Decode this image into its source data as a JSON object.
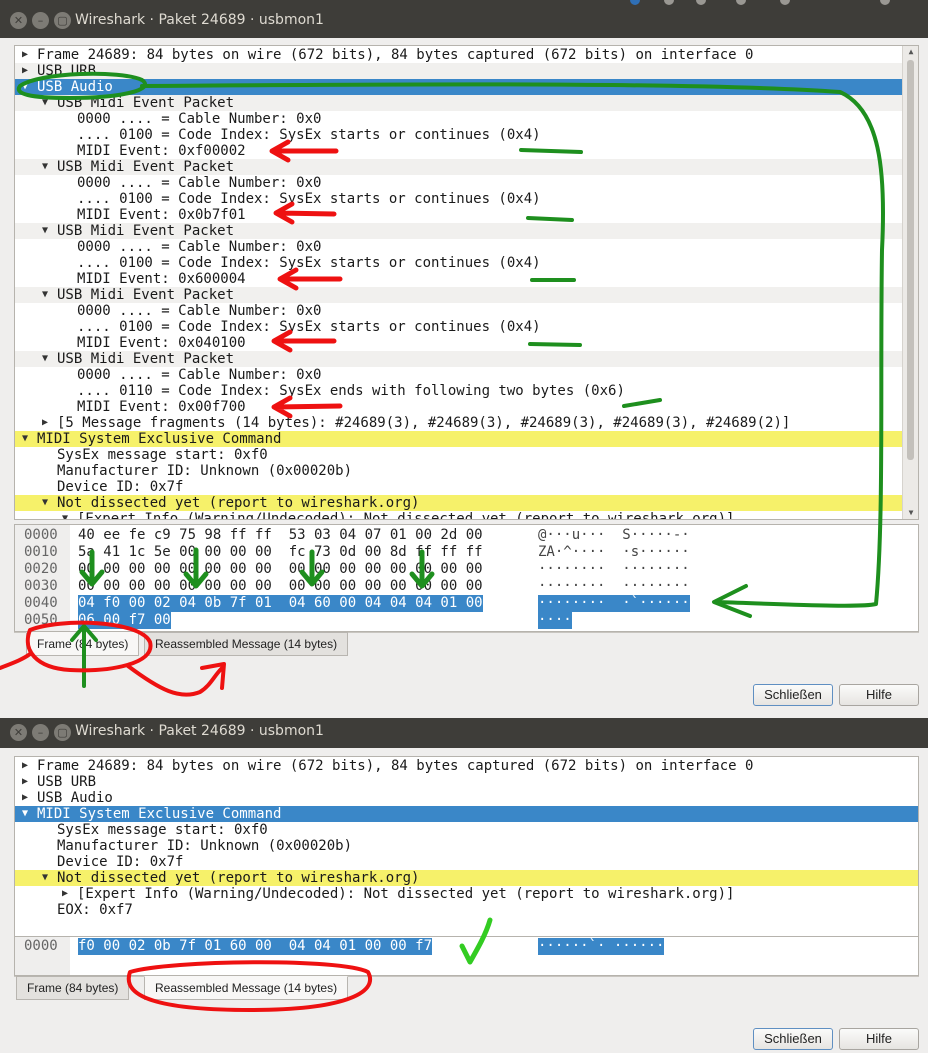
{
  "top_window": {
    "title": "Wireshark · Paket 24689 · usbmon1",
    "tree_rows": [
      {
        "text": "Frame 24689: 84 bytes on wire (672 bits), 84 bytes captured (672 bits) on interface 0",
        "expander": "collapsed",
        "level": 0,
        "style": "normal"
      },
      {
        "text": "USB URB",
        "expander": "collapsed",
        "level": 0,
        "style": "alt"
      },
      {
        "text": "USB Audio",
        "expander": "expanded",
        "level": 0,
        "style": "selected"
      },
      {
        "text": "USB Midi Event Packet",
        "expander": "expanded",
        "level": 1,
        "style": "alt"
      },
      {
        "text": "0000 .... = Cable Number: 0x0",
        "expander": "none",
        "level": 2,
        "style": "normal"
      },
      {
        "text": ".... 0100 = Code Index: SysEx starts or continues (0x4)",
        "expander": "none",
        "level": 2,
        "style": "normal"
      },
      {
        "text": "MIDI Event: 0xf00002",
        "expander": "none",
        "level": 2,
        "style": "normal"
      },
      {
        "text": "USB Midi Event Packet",
        "expander": "expanded",
        "level": 1,
        "style": "alt"
      },
      {
        "text": "0000 .... = Cable Number: 0x0",
        "expander": "none",
        "level": 2,
        "style": "normal"
      },
      {
        "text": ".... 0100 = Code Index: SysEx starts or continues (0x4)",
        "expander": "none",
        "level": 2,
        "style": "normal"
      },
      {
        "text": "MIDI Event: 0x0b7f01",
        "expander": "none",
        "level": 2,
        "style": "normal"
      },
      {
        "text": "USB Midi Event Packet",
        "expander": "expanded",
        "level": 1,
        "style": "alt"
      },
      {
        "text": "0000 .... = Cable Number: 0x0",
        "expander": "none",
        "level": 2,
        "style": "normal"
      },
      {
        "text": ".... 0100 = Code Index: SysEx starts or continues (0x4)",
        "expander": "none",
        "level": 2,
        "style": "normal"
      },
      {
        "text": "MIDI Event: 0x600004",
        "expander": "none",
        "level": 2,
        "style": "normal"
      },
      {
        "text": "USB Midi Event Packet",
        "expander": "expanded",
        "level": 1,
        "style": "alt"
      },
      {
        "text": "0000 .... = Cable Number: 0x0",
        "expander": "none",
        "level": 2,
        "style": "normal"
      },
      {
        "text": ".... 0100 = Code Index: SysEx starts or continues (0x4)",
        "expander": "none",
        "level": 2,
        "style": "normal"
      },
      {
        "text": "MIDI Event: 0x040100",
        "expander": "none",
        "level": 2,
        "style": "normal"
      },
      {
        "text": "USB Midi Event Packet",
        "expander": "expanded",
        "level": 1,
        "style": "alt"
      },
      {
        "text": "0000 .... = Cable Number: 0x0",
        "expander": "none",
        "level": 2,
        "style": "normal"
      },
      {
        "text": ".... 0110 = Code Index: SysEx ends with following two bytes (0x6)",
        "expander": "none",
        "level": 2,
        "style": "normal"
      },
      {
        "text": "MIDI Event: 0x00f700",
        "expander": "none",
        "level": 2,
        "style": "normal"
      },
      {
        "text": "[5 Message fragments (14 bytes): #24689(3), #24689(3), #24689(3), #24689(3), #24689(2)]",
        "expander": "collapsed",
        "level": 1,
        "style": "normal"
      },
      {
        "text": "MIDI System Exclusive Command",
        "expander": "expanded",
        "level": 0,
        "style": "warning"
      },
      {
        "text": "SysEx message start: 0xf0",
        "expander": "none",
        "level": 1,
        "style": "normal"
      },
      {
        "text": "Manufacturer ID: Unknown (0x00020b)",
        "expander": "none",
        "level": 1,
        "style": "normal"
      },
      {
        "text": "Device ID: 0x7f",
        "expander": "none",
        "level": 1,
        "style": "normal"
      },
      {
        "text": "Not dissected yet (report to wireshark.org)",
        "expander": "expanded",
        "level": 1,
        "style": "warning"
      },
      {
        "text": "[Expert Info (Warning/Undecoded): Not dissected yet (report to wireshark.org)]",
        "expander": "expanded",
        "level": 2,
        "style": "normal"
      }
    ],
    "hex_rows": [
      {
        "offset": "0000",
        "bytes": "40 ee fe c9 75 98 ff ff  53 03 04 07 01 00 2d 00",
        "ascii": "@···u···  S·····-·"
      },
      {
        "offset": "0010",
        "bytes": "5a 41 1c 5e 00 00 00 00  fc 73 0d 00 8d ff ff ff",
        "ascii": "ZA·^····  ·s······"
      },
      {
        "offset": "0020",
        "bytes": "00 00 00 00 00 00 00 00  00 00 00 00 00 00 00 00",
        "ascii": "········  ········"
      },
      {
        "offset": "0030",
        "bytes": "00 00 00 00 00 00 00 00  00 00 00 00 00 00 00 00",
        "ascii": "········  ········"
      },
      {
        "offset": "0040",
        "bytes": "04 f0 00 02 04 0b 7f 01  04 60 00 04 04 04 01 00",
        "ascii": "········  ·`······",
        "highlight": true
      },
      {
        "offset": "0050",
        "bytes": "06 00 f7 00",
        "ascii": "····",
        "highlight": true
      }
    ],
    "tabs": [
      "Frame (84 bytes)",
      "Reassembled Message (14 bytes)"
    ],
    "active_tab": 0,
    "buttons": {
      "close": "Schließen",
      "help": "Hilfe"
    }
  },
  "bottom_window": {
    "title": "Wireshark · Paket 24689 · usbmon1",
    "tree_rows": [
      {
        "text": "Frame 24689: 84 bytes on wire (672 bits), 84 bytes captured (672 bits) on interface 0",
        "expander": "collapsed",
        "level": 0,
        "style": "normal"
      },
      {
        "text": "USB URB",
        "expander": "collapsed",
        "level": 0,
        "style": "normal"
      },
      {
        "text": "USB Audio",
        "expander": "collapsed",
        "level": 0,
        "style": "normal"
      },
      {
        "text": "MIDI System Exclusive Command",
        "expander": "expanded",
        "level": 0,
        "style": "selected"
      },
      {
        "text": "SysEx message start: 0xf0",
        "expander": "none",
        "level": 1,
        "style": "normal"
      },
      {
        "text": "Manufacturer ID: Unknown (0x00020b)",
        "expander": "none",
        "level": 1,
        "style": "normal"
      },
      {
        "text": "Device ID: 0x7f",
        "expander": "none",
        "level": 1,
        "style": "normal"
      },
      {
        "text": "Not dissected yet (report to wireshark.org)",
        "expander": "expanded",
        "level": 1,
        "style": "warning"
      },
      {
        "text": "[Expert Info (Warning/Undecoded): Not dissected yet (report to wireshark.org)]",
        "expander": "collapsed",
        "level": 2,
        "style": "normal"
      },
      {
        "text": "EOX: 0xf7",
        "expander": "none",
        "level": 1,
        "style": "normal"
      }
    ],
    "hex_rows": [
      {
        "offset": "0000",
        "bytes": "f0 00 02 0b 7f 01 60 00  04 04 01 00 00 f7",
        "ascii": "······`· ······",
        "highlight": true
      }
    ],
    "tabs": [
      "Frame (84 bytes)",
      "Reassembled Message (14 bytes)"
    ],
    "active_tab": 1,
    "buttons": {
      "close": "Schließen",
      "help": "Hilfe"
    }
  },
  "colors": {
    "selection": "#3a87c8",
    "warning_row": "#f6f16a",
    "annotation_green": "#1e8f1e",
    "annotation_red": "#ee1111",
    "annotation_lime": "#33cc22"
  },
  "icons": {
    "expanded": "triangle-down-icon",
    "collapsed": "triangle-right-icon",
    "window_close": "close-icon",
    "window_minimize": "minimize-icon",
    "window_maximize": "maximize-icon"
  }
}
